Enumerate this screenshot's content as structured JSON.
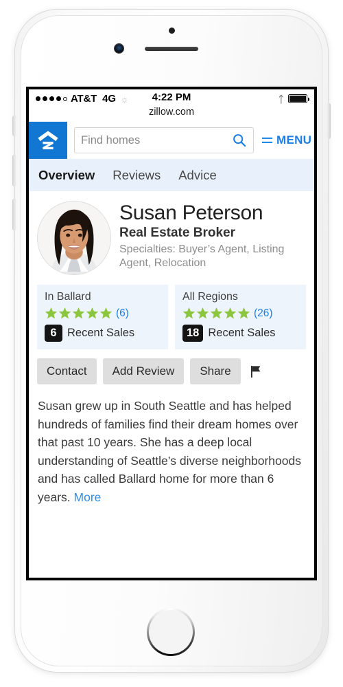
{
  "status_bar": {
    "signal_dots_filled": 4,
    "signal_dots_total": 5,
    "carrier": "AT&T",
    "network": "4G",
    "activity_icon": "spinner-icon",
    "time": "4:22 PM",
    "bluetooth_icon": "bluetooth-icon",
    "battery_icon": "battery-full-icon",
    "url": "zillow.com"
  },
  "navbar": {
    "logo_name": "zillow-logo",
    "search_placeholder": "Find homes",
    "search_value": "",
    "search_icon": "search-icon",
    "menu_icon": "hamburger-menu-icon",
    "menu_label": "MENU"
  },
  "tabs": [
    {
      "label": "Overview",
      "active": true
    },
    {
      "label": "Reviews",
      "active": false
    },
    {
      "label": "Advice",
      "active": false
    }
  ],
  "profile": {
    "avatar_name": "agent-avatar",
    "name": "Susan Peterson",
    "title": "Real Estate Broker",
    "specialties": "Specialties: Buyer’s Agent, Listing Agent, Relocation"
  },
  "stat_cards": [
    {
      "title": "In Ballard",
      "rating_stars": 5,
      "review_count": "(6)",
      "recent_sales_count": "6",
      "recent_sales_label": "Recent Sales"
    },
    {
      "title": "All Regions",
      "rating_stars": 5,
      "review_count": "(26)",
      "recent_sales_count": "18",
      "recent_sales_label": "Recent Sales"
    }
  ],
  "actions": {
    "contact": "Contact",
    "add_review": "Add Review",
    "share": "Share",
    "flag_icon": "flag-icon"
  },
  "bio": {
    "text": "Susan grew up in South Seattle and has helped hundreds of families find their dream homes over that past 10 years. She has a deep local understanding of Seattle’s diverse neighborhoods and has called Ballard home for more than 6 years. ",
    "more_label": "More"
  },
  "colors": {
    "brand_blue": "#1277d3",
    "link_blue": "#1b7ee8",
    "star_green": "#8cc63e",
    "tab_bg": "#e8f1fb",
    "card_bg": "#eef4fc",
    "badge_black": "#141414",
    "button_gray": "#dedede"
  }
}
